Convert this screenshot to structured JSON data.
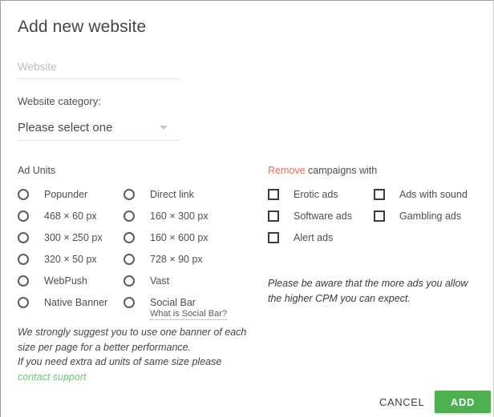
{
  "dialog": {
    "title": "Add new website"
  },
  "website_field": {
    "placeholder": "Website",
    "value": ""
  },
  "category": {
    "label": "Website category:",
    "selected": "Please select one",
    "arrow_icon": "chevron-down-icon"
  },
  "ad_units": {
    "heading": "Ad Units",
    "column_left": [
      {
        "label": "Popunder"
      },
      {
        "label": "468 × 60 px"
      },
      {
        "label": "300 × 250 px"
      },
      {
        "label": "320 × 50 px"
      },
      {
        "label": "WebPush"
      },
      {
        "label": "Native Banner"
      }
    ],
    "column_right": [
      {
        "label": "Direct link"
      },
      {
        "label": "160 × 300 px"
      },
      {
        "label": "160 × 600 px"
      },
      {
        "label": "728 × 90 px"
      },
      {
        "label": "Vast"
      },
      {
        "label": "Social Bar"
      }
    ],
    "social_bar_help": "What is Social Bar?"
  },
  "remove_campaigns": {
    "heading_highlight": "Remove",
    "heading_rest": " campaigns with",
    "highlight_color": "#ea6d63",
    "column_left": [
      {
        "label": "Erotic ads"
      },
      {
        "label": "Software ads"
      },
      {
        "label": "Alert ads"
      }
    ],
    "column_right": [
      {
        "label": "Ads with sound"
      },
      {
        "label": "Gambling ads"
      }
    ]
  },
  "notes": {
    "left_line1": "We strongly suggest you to use one banner of each size per page for a better performance.",
    "left_line2_prefix": "If you need extra ad units of same size please ",
    "left_line2_link": "contact support",
    "left_link_color": "#76c278",
    "right": "Please be aware that the more ads you allow the higher CPM you can expect."
  },
  "actions": {
    "cancel_label": "CANCEL",
    "add_label": "ADD",
    "add_color": "#4caf50"
  }
}
